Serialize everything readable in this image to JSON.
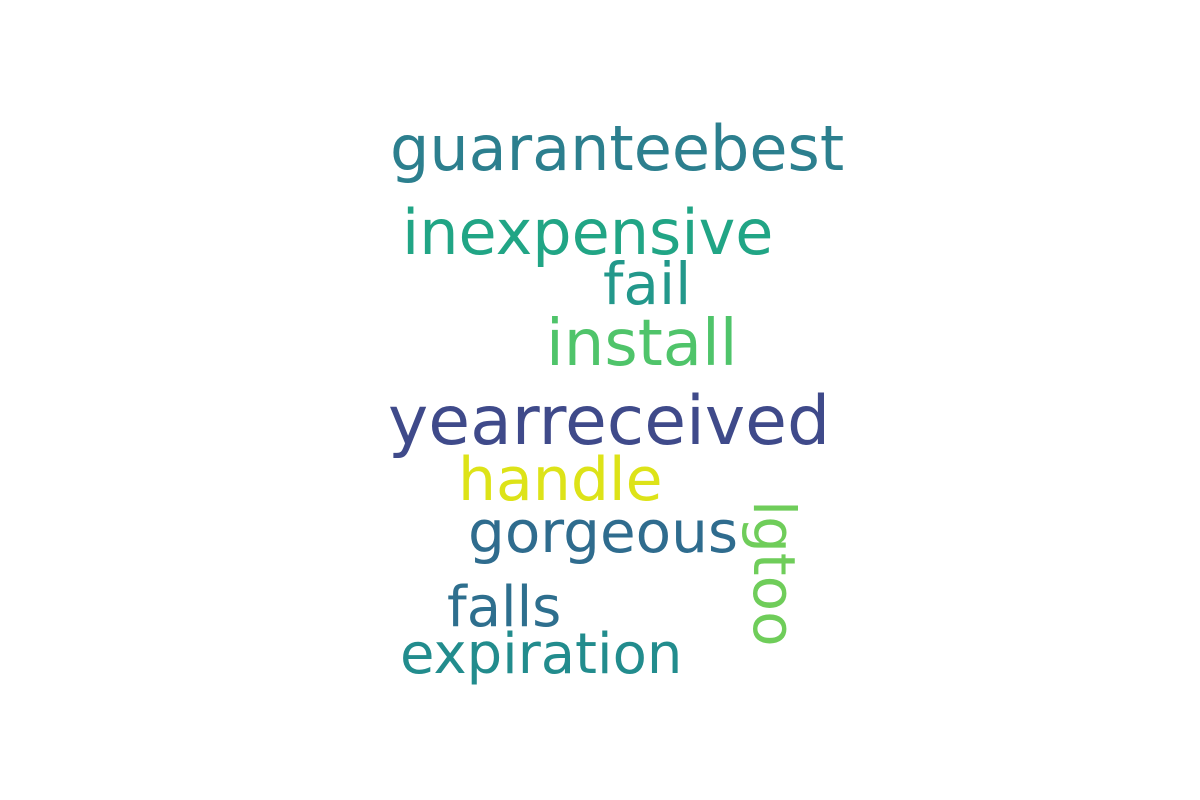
{
  "words": [
    {
      "text": "guaranteebest",
      "color": "#2c7f8e"
    },
    {
      "text": "inexpensive",
      "color": "#21a585"
    },
    {
      "text": "fail",
      "color": "#23988b"
    },
    {
      "text": "install",
      "color": "#4fc46a"
    },
    {
      "text": "yearreceived",
      "color": "#3f4a8a"
    },
    {
      "text": "handle",
      "color": "#dde318"
    },
    {
      "text": "gorgeous",
      "color": "#2f6c8e"
    },
    {
      "text": "falls",
      "color": "#2e6f8e"
    },
    {
      "text": "expiration",
      "color": "#228c8d"
    },
    {
      "text": "lgtoo",
      "color": "#6fcd5a"
    }
  ]
}
